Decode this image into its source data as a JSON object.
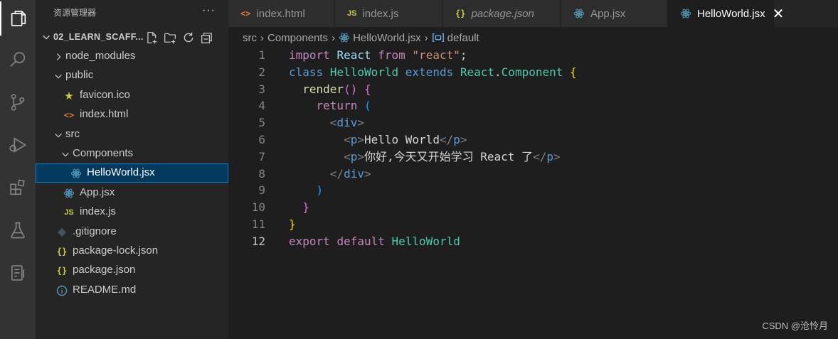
{
  "activity_bar": {
    "items": [
      {
        "name": "explorer-icon",
        "active": true
      },
      {
        "name": "search-icon"
      },
      {
        "name": "source-control-icon"
      },
      {
        "name": "run-debug-icon"
      },
      {
        "name": "extensions-icon"
      },
      {
        "name": "testing-icon"
      },
      {
        "name": "remote-explorer-icon"
      }
    ]
  },
  "sidebar": {
    "title": "资源管理器",
    "more": "···",
    "project": "02_LEARN_SCAFF...",
    "tree": [
      {
        "label": "node_modules",
        "kind": "folder",
        "state": "collapsed"
      },
      {
        "label": "public",
        "kind": "folder",
        "state": "expanded"
      },
      {
        "label": "favicon.ico",
        "kind": "star"
      },
      {
        "label": "index.html",
        "kind": "html"
      },
      {
        "label": "src",
        "kind": "folder",
        "state": "expanded"
      },
      {
        "label": "Components",
        "kind": "folder",
        "state": "expanded"
      },
      {
        "label": "HelloWorld.jsx",
        "kind": "react",
        "selected": true
      },
      {
        "label": "App.jsx",
        "kind": "react"
      },
      {
        "label": "index.js",
        "kind": "js"
      },
      {
        "label": ".gitignore",
        "kind": "git"
      },
      {
        "label": "package-lock.json",
        "kind": "json"
      },
      {
        "label": "package.json",
        "kind": "json"
      },
      {
        "label": "README.md",
        "kind": "info"
      }
    ]
  },
  "tabs": [
    {
      "label": "index.html",
      "icon": "<>",
      "kind": "html"
    },
    {
      "label": "index.js",
      "icon": "JS",
      "kind": "js"
    },
    {
      "label": "package.json",
      "icon": "{}",
      "kind": "json",
      "italic": true
    },
    {
      "label": "App.jsx",
      "icon": "react",
      "kind": "react"
    },
    {
      "label": "HelloWorld.jsx",
      "icon": "react",
      "kind": "react",
      "active": true,
      "close": "✕"
    }
  ],
  "breadcrumb": {
    "parts": [
      "src",
      "Components",
      "HelloWorld.jsx",
      "default"
    ]
  },
  "editor": {
    "current_line": 12,
    "lines": [
      {
        "n": "1",
        "tokens": [
          [
            "import",
            "t-ctl"
          ],
          [
            " ",
            "t-pl"
          ],
          [
            "React",
            "t-var"
          ],
          [
            " ",
            "t-pl"
          ],
          [
            "from",
            "t-ctl"
          ],
          [
            " ",
            "t-pl"
          ],
          [
            "\"react\"",
            "t-str"
          ],
          [
            ";",
            "t-pl"
          ]
        ]
      },
      {
        "n": "2",
        "tokens": [
          [
            "class",
            "t-kw"
          ],
          [
            " ",
            "t-pl"
          ],
          [
            "HelloWorld",
            "t-cls"
          ],
          [
            " ",
            "t-pl"
          ],
          [
            "extends",
            "t-kw"
          ],
          [
            " ",
            "t-pl"
          ],
          [
            "React",
            "t-cls"
          ],
          [
            ".",
            "t-pl"
          ],
          [
            "Component",
            "t-cls"
          ],
          [
            " ",
            "t-pl"
          ],
          [
            "{",
            "t-b1"
          ]
        ]
      },
      {
        "n": "3",
        "tokens": [
          [
            "  ",
            "t-pl"
          ],
          [
            "render",
            "t-fn"
          ],
          [
            "()",
            "t-b2"
          ],
          [
            " ",
            "t-pl"
          ],
          [
            "{",
            "t-b2"
          ]
        ]
      },
      {
        "n": "4",
        "tokens": [
          [
            "    ",
            "t-pl"
          ],
          [
            "return",
            "t-ctl"
          ],
          [
            " ",
            "t-pl"
          ],
          [
            "(",
            "t-b3"
          ]
        ]
      },
      {
        "n": "5",
        "tokens": [
          [
            "      ",
            "t-pl"
          ],
          [
            "<",
            "t-tagb"
          ],
          [
            "div",
            "t-tag"
          ],
          [
            ">",
            "t-tagb"
          ]
        ]
      },
      {
        "n": "6",
        "tokens": [
          [
            "        ",
            "t-pl"
          ],
          [
            "<",
            "t-tagb"
          ],
          [
            "p",
            "t-tag"
          ],
          [
            ">",
            "t-tagb"
          ],
          [
            "Hello World",
            "t-pl"
          ],
          [
            "</",
            "t-tagb"
          ],
          [
            "p",
            "t-tag"
          ],
          [
            ">",
            "t-tagb"
          ]
        ]
      },
      {
        "n": "7",
        "tokens": [
          [
            "        ",
            "t-pl"
          ],
          [
            "<",
            "t-tagb"
          ],
          [
            "p",
            "t-tag"
          ],
          [
            ">",
            "t-tagb"
          ],
          [
            "你好,今天又开始学习 React 了",
            "t-pl"
          ],
          [
            "</",
            "t-tagb"
          ],
          [
            "p",
            "t-tag"
          ],
          [
            ">",
            "t-tagb"
          ]
        ]
      },
      {
        "n": "8",
        "tokens": [
          [
            "      ",
            "t-pl"
          ],
          [
            "</",
            "t-tagb"
          ],
          [
            "div",
            "t-tag"
          ],
          [
            ">",
            "t-tagb"
          ]
        ]
      },
      {
        "n": "9",
        "tokens": [
          [
            "    ",
            "t-pl"
          ],
          [
            ")",
            "t-b3"
          ]
        ]
      },
      {
        "n": "10",
        "tokens": [
          [
            "  ",
            "t-pl"
          ],
          [
            "}",
            "t-b2"
          ]
        ]
      },
      {
        "n": "11",
        "tokens": [
          [
            "}",
            "t-b1"
          ]
        ]
      },
      {
        "n": "12",
        "tokens": [
          [
            "export",
            "t-ctl"
          ],
          [
            " ",
            "t-pl"
          ],
          [
            "default",
            "t-ctl"
          ],
          [
            " ",
            "t-pl"
          ],
          [
            "HelloWorld",
            "t-cls"
          ]
        ]
      }
    ]
  },
  "watermark": "CSDN @沧怜月",
  "colors": {
    "react": "#519aba",
    "html": "#e37933",
    "js": "#cbcb41",
    "json": "#cbcb41",
    "star": "#cbcb41",
    "git": "#41535b",
    "info": "#519aba",
    "selection_bg": "#04395e",
    "selection_border": "#007fd4"
  }
}
